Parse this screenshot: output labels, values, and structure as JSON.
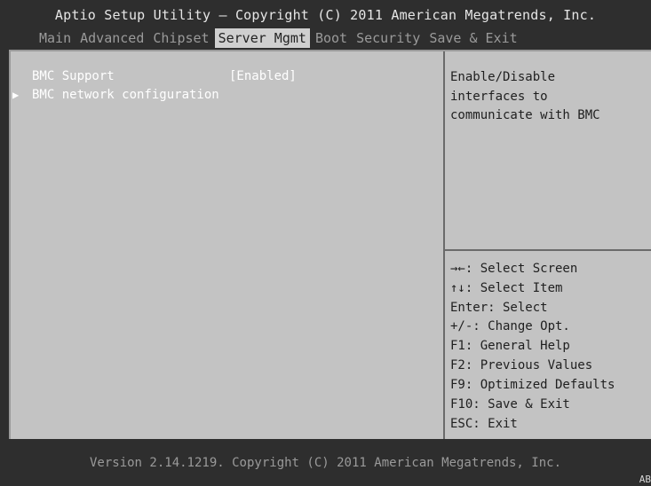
{
  "header": {
    "title": "Aptio Setup Utility – Copyright (C) 2011 American Megatrends, Inc."
  },
  "tabs": [
    {
      "label": "Main",
      "active": false
    },
    {
      "label": "Advanced",
      "active": false
    },
    {
      "label": "Chipset",
      "active": false
    },
    {
      "label": "Server Mgmt",
      "active": true
    },
    {
      "label": "Boot",
      "active": false
    },
    {
      "label": "Security",
      "active": false
    },
    {
      "label": "Save & Exit",
      "active": false
    }
  ],
  "settings": [
    {
      "label": "BMC Support",
      "value": "[Enabled]",
      "submenu": false
    },
    {
      "label": "BMC network configuration",
      "value": "",
      "submenu": true,
      "arrow_icon": "triangle-right"
    }
  ],
  "help": {
    "lines": [
      "Enable/Disable",
      "interfaces to",
      "communicate with BMC"
    ]
  },
  "keys": [
    "→←: Select Screen",
    "↑↓: Select Item",
    "Enter: Select",
    "+/-: Change Opt.",
    "F1: General Help",
    "F2: Previous Values",
    "F9: Optimized Defaults",
    "F10: Save & Exit",
    "ESC: Exit"
  ],
  "footer": {
    "version": "Version 2.14.1219. Copyright (C) 2011 American Megatrends, Inc.",
    "corner": "AB"
  },
  "colors": {
    "background": "#2e2e2e",
    "panel": "#c3c3c3",
    "active_tab_bg": "#cfcfcf",
    "tab_inactive": "#9a9a9a",
    "setting_text": "#ffffff",
    "help_text": "#1f1f1f"
  }
}
